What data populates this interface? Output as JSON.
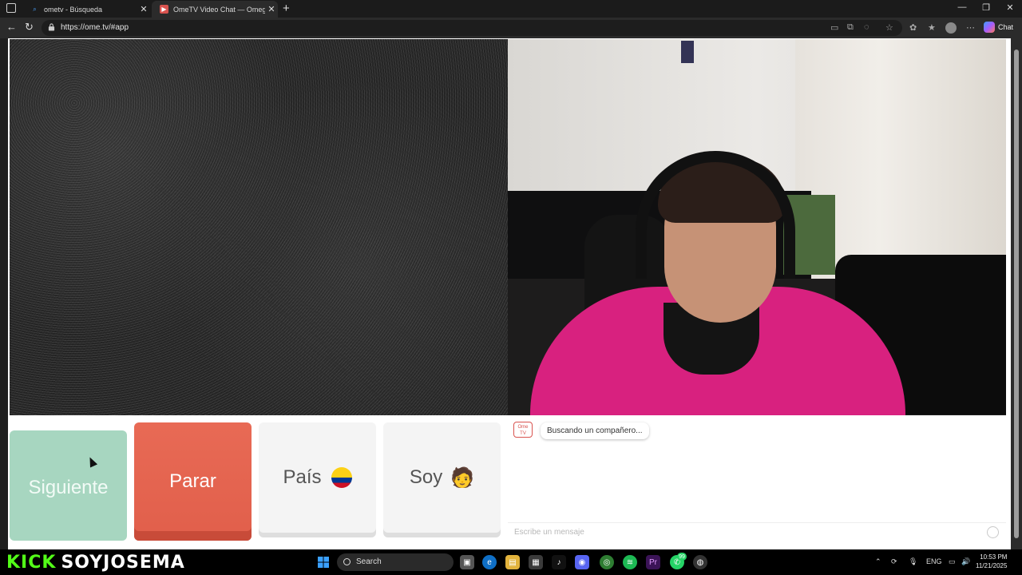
{
  "browser": {
    "tabs": [
      {
        "title": "ometv - Búsqueda",
        "active": false
      },
      {
        "title": "OmeTV Video Chat — Omeg",
        "active": true
      }
    ],
    "address": "https://ome.tv/#app",
    "chat_button": "Chat"
  },
  "controls": {
    "next_label": "Siguiente",
    "stop_label": "Parar",
    "country_label": "País",
    "country_flag": "Colombia",
    "gender_label": "Soy",
    "gender_emoji": "🧑"
  },
  "chat": {
    "logo_text": "Ome TV",
    "status_message": "Buscando un compañero...",
    "input_placeholder": "Escribe un mensaje"
  },
  "taskbar": {
    "brand_kick": "KICK",
    "brand_user": "SOYJOSEMA",
    "search_placeholder": "Search",
    "language": "ENG",
    "time": "10:53 PM",
    "date": "11/21/2025",
    "badge_count": "99"
  },
  "colors": {
    "next_button": "#a7d6c0",
    "stop_button": "#e15f4b",
    "kick_green": "#53fc18"
  }
}
